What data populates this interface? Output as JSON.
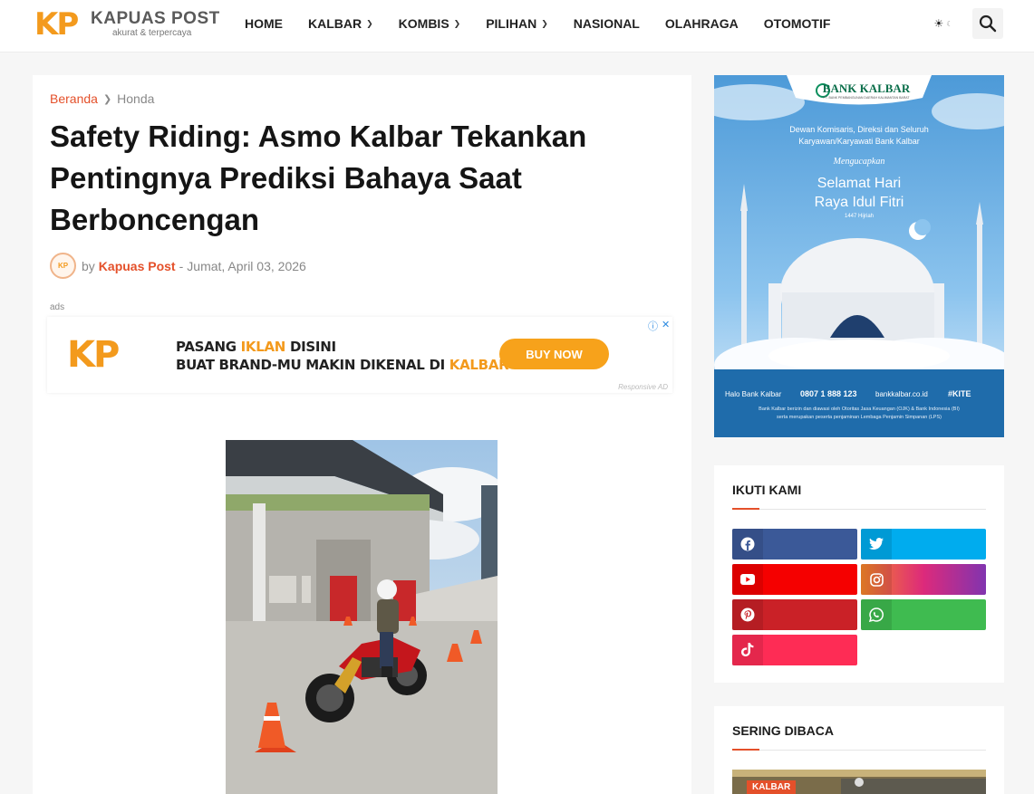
{
  "brand": {
    "mark": "KP",
    "name": "KAPUAS POST",
    "tagline": "akurat & terpercaya",
    "accent_color": "#e4502a",
    "logo_color": "#f39a1d"
  },
  "nav": {
    "items": [
      {
        "label": "HOME",
        "dropdown": false
      },
      {
        "label": "KALBAR",
        "dropdown": true
      },
      {
        "label": "KOMBIS",
        "dropdown": true
      },
      {
        "label": "PILIHAN",
        "dropdown": true
      },
      {
        "label": "NASIONAL",
        "dropdown": false
      },
      {
        "label": "OLAHRAGA",
        "dropdown": false
      },
      {
        "label": "OTOMOTIF",
        "dropdown": false
      }
    ],
    "theme_icon": "sun-icon",
    "search_icon": "search-icon"
  },
  "article": {
    "breadcrumb": {
      "home": "Beranda",
      "category": "Honda"
    },
    "title": "Safety Riding: Asmo Kalbar Tekankan Pentingnya Prediksi Bahaya Saat Berboncengan",
    "meta": {
      "by": "by",
      "author": "Kapuas Post",
      "separator": "-",
      "date": "Jumat, April 03, 2026"
    },
    "ads_label": "ads",
    "ad": {
      "logo": "KP",
      "line1_pre": "PASANG ",
      "line1_hl": "IKLAN",
      "line1_post": " DISINI",
      "line2_pre": "BUAT BRAND-MU MAKIN DIKENAL DI ",
      "line2_hl": "KALBAR",
      "button": "BUY NOW",
      "footer": "Responsive AD"
    }
  },
  "sidebar": {
    "bank_ad": {
      "brand": "BANK KALBAR",
      "subtitle": "PT. BANK PEMBANGUNAN DAERAH KALIMANTAN BARAT",
      "line1": "Dewan Komisaris, Direksi dan Seluruh",
      "line2": "Karyawan/Karyawati Bank Kalbar",
      "mengucapkan": "Mengucapkan",
      "greet1": "Selamat Hari",
      "greet2": "Raya Idul Fitri",
      "hijri": "1447 Hijriah",
      "halo": "Halo Bank Kalbar",
      "phone": "0807 1 888 123",
      "site": "bankkalbar.co.id",
      "hashtag": "#KITE",
      "disclaimer1": "Bank Kalbar berizin dan diawasi oleh Otoritas Jasa Keuangan (OJK) & Bank Indonesia (BI)",
      "disclaimer2": "serta merupakan peserta penjaminan Lembaga Penjamin Simpanan (LPS)"
    },
    "follow": {
      "title": "IKUTI KAMI",
      "buttons": [
        {
          "name": "facebook",
          "color": "#3b5998",
          "icon": "facebook-icon"
        },
        {
          "name": "twitter",
          "color": "#00acee",
          "icon": "twitter-icon"
        },
        {
          "name": "youtube",
          "color": "#f50000",
          "icon": "youtube-icon"
        },
        {
          "name": "instagram",
          "color": "#c13584",
          "icon": "instagram-icon"
        },
        {
          "name": "pinterest",
          "color": "#ca2127",
          "icon": "pinterest-icon"
        },
        {
          "name": "whatsapp",
          "color": "#3fbb50",
          "icon": "whatsapp-icon"
        },
        {
          "name": "tiktok",
          "color": "#fe2c55",
          "icon": "tiktok-icon"
        }
      ]
    },
    "popular": {
      "title": "SERING DIBACA",
      "first_tag": "KALBAR"
    }
  }
}
